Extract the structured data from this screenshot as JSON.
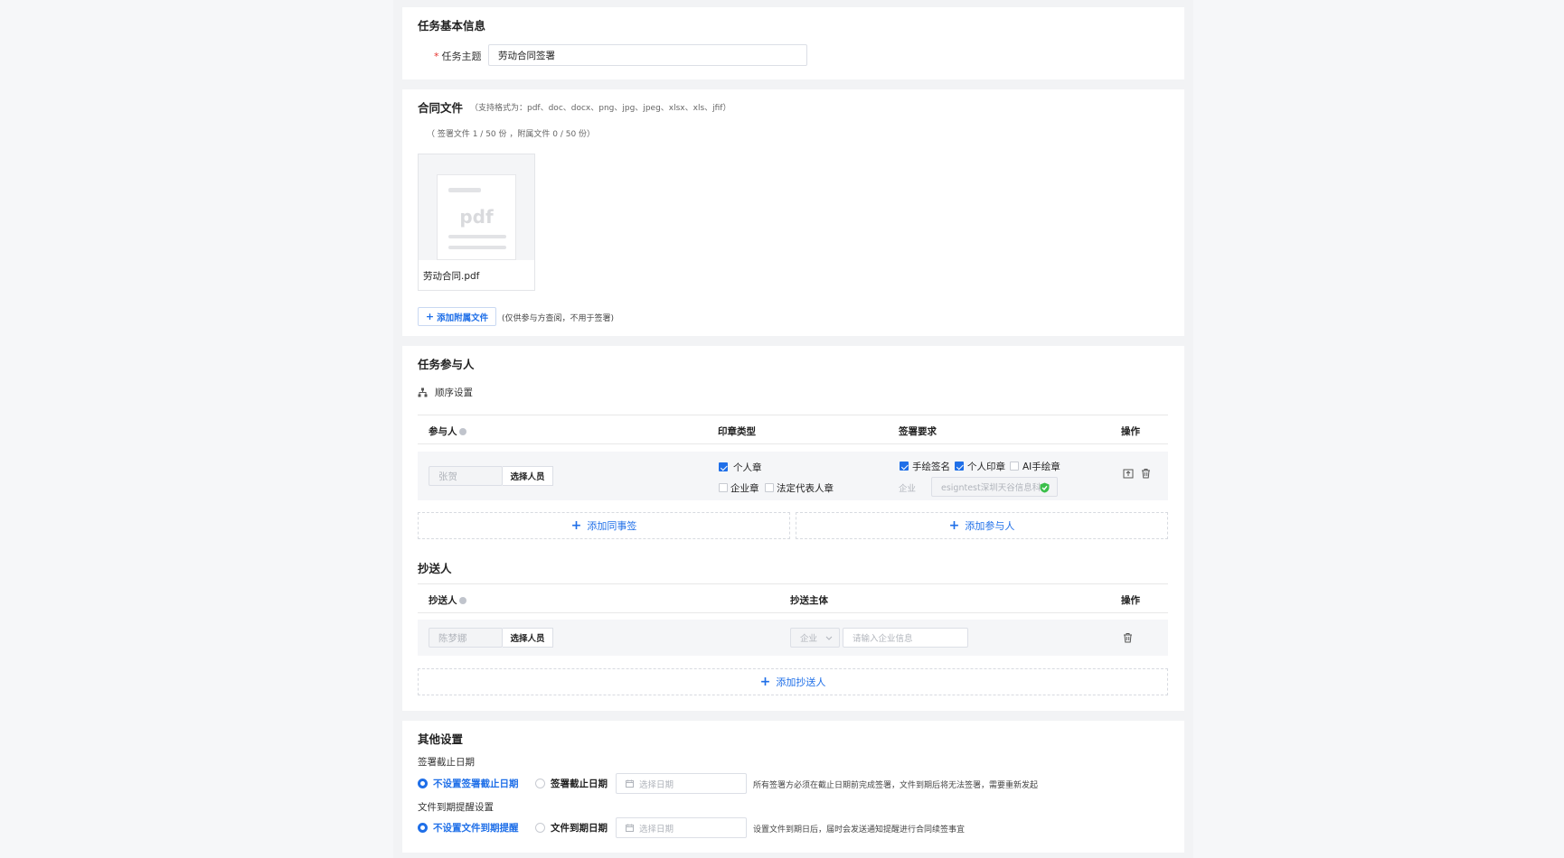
{
  "basic": {
    "title": "任务基本信息",
    "subject_required": "*",
    "subject_label": "任务主题",
    "subject_value": "劳动合同签署"
  },
  "contract": {
    "title": "合同文件",
    "formats_note": "（支持格式为：pdf、doc、docx、png、jpg、jpeg、xlsx、xls、jfif）",
    "count_note": "（ 签署文件 1 / 50 份 ，附属文件 0 / 50 份）",
    "file_type_label": "pdf",
    "file_name": "劳动合同.pdf",
    "add_attachment_label": "添加附属文件",
    "attachment_note": "(仅供参与方查阅，不用于签署)"
  },
  "participants": {
    "title": "任务参与人",
    "order_label": "顺序设置",
    "columns": {
      "participant": "参与人",
      "seal_type": "印章类型",
      "sign_req": "签署要求",
      "action": "操作"
    },
    "row": {
      "name_placeholder": "张贺",
      "select_button": "选择人员",
      "seal_personal": "个人章",
      "seal_company": "企业章",
      "seal_legal": "法定代表人章",
      "req_handwrite": "手绘签名",
      "req_personal_seal": "个人印章",
      "req_ai_seal": "AI手绘章",
      "company_label": "企业",
      "company_value": "esigntest深圳天谷信息科"
    },
    "add_colleague_label": "添加同事签",
    "add_participant_label": "添加参与人"
  },
  "cc": {
    "title": "抄送人",
    "columns": {
      "cc_person": "抄送人",
      "cc_entity": "抄送主体",
      "action": "操作"
    },
    "row": {
      "name_placeholder": "陈梦娜",
      "select_button": "选择人员",
      "entity_type": "企业",
      "entity_placeholder": "请输入企业信息"
    },
    "add_cc_label": "添加抄送人"
  },
  "other": {
    "title": "其他设置",
    "deadline_title": "签署截止日期",
    "deadline_option_none": "不设置签署截止日期",
    "deadline_option_set": "签署截止日期",
    "deadline_placeholder": "选择日期",
    "deadline_tip": "所有签署方必须在截止日期前完成签署，文件到期后将无法签署，需要重新发起",
    "expire_title": "文件到期提醒设置",
    "expire_option_none": "不设置文件到期提醒",
    "expire_option_set": "文件到期日期",
    "expire_placeholder": "选择日期",
    "expire_tip": "设置文件到期日后，届时会发送通知提醒进行合同续签事宜"
  },
  "colors": {
    "primary": "#1f6fe8",
    "success": "#3bbf4a",
    "required": "#e5322d"
  }
}
